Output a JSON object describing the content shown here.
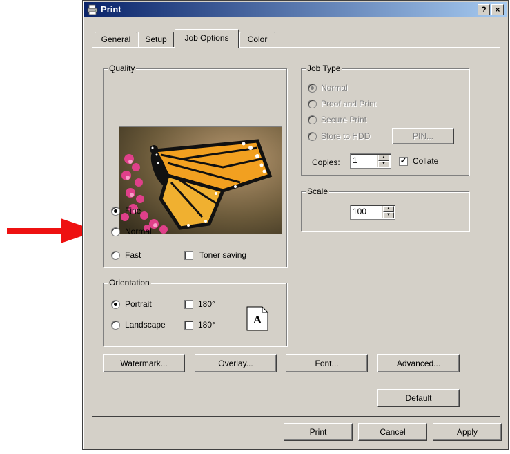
{
  "window": {
    "title": "Print",
    "help_label": "?",
    "close_label": "×"
  },
  "tabs": [
    {
      "label": "General",
      "active": false
    },
    {
      "label": "Setup",
      "active": false
    },
    {
      "label": "Job Options",
      "active": true
    },
    {
      "label": "Color",
      "active": false
    }
  ],
  "quality": {
    "legend": "Quality",
    "preview_icon": "butterfly-preview-image",
    "options": [
      {
        "label": "Fine",
        "selected": true
      },
      {
        "label": "Normal",
        "selected": false
      },
      {
        "label": "Fast",
        "selected": false
      }
    ],
    "toner_saving": {
      "label": "Toner saving",
      "checked": false
    }
  },
  "orientation": {
    "legend": "Orientation",
    "portrait": {
      "label": "Portrait",
      "selected": true
    },
    "landscape": {
      "label": "Landscape",
      "selected": false
    },
    "rotate_portrait": {
      "label": "180°",
      "checked": false
    },
    "rotate_landscape": {
      "label": "180°",
      "checked": false
    },
    "page_glyph": "A"
  },
  "job_type": {
    "legend": "Job Type",
    "options": [
      {
        "label": "Normal",
        "selected": true
      },
      {
        "label": "Proof and Print",
        "selected": false
      },
      {
        "label": "Secure Print",
        "selected": false
      },
      {
        "label": "Store to HDD",
        "selected": false
      }
    ],
    "pin_label": "PIN...",
    "copies_label": "Copies:",
    "copies_value": "1",
    "collate": {
      "label": "Collate",
      "checked": true
    }
  },
  "scale": {
    "legend": "Scale",
    "value": "100"
  },
  "buttons": {
    "watermark": "Watermark...",
    "overlay": "Overlay...",
    "font": "Font...",
    "advanced": "Advanced...",
    "default": "Default"
  },
  "footer": {
    "print": "Print",
    "cancel": "Cancel",
    "apply": "Apply"
  },
  "annotation": {
    "arrow_color": "#ee1111",
    "points_to": "Normal"
  },
  "colors": {
    "dialog_bg": "#d4d0c8",
    "title_start": "#0a246a",
    "title_end": "#a6caf0"
  }
}
